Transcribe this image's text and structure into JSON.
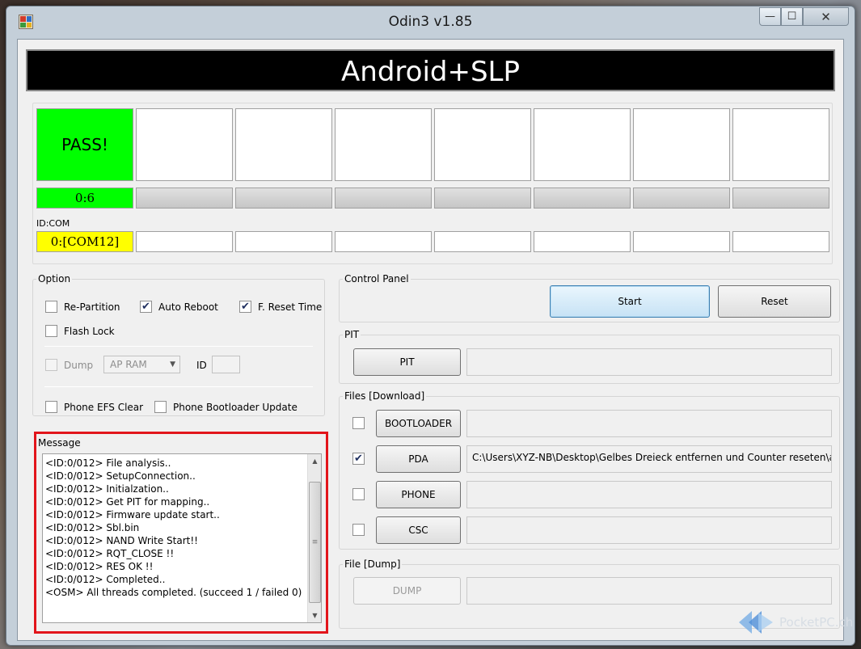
{
  "window": {
    "title": "Odin3 v1.85",
    "close_glyph": "✕",
    "minimize_glyph": "—",
    "maximize_glyph": "☐"
  },
  "banner": {
    "text": "Android+SLP"
  },
  "ports": {
    "status": [
      "PASS!",
      "",
      "",
      "",
      "",
      "",
      "",
      ""
    ],
    "progress": [
      "0:6",
      "",
      "",
      "",
      "",
      "",
      "",
      ""
    ],
    "idcom_label": "ID:COM",
    "com": [
      "0:[COM12]",
      "",
      "",
      "",
      "",
      "",
      "",
      ""
    ]
  },
  "option": {
    "title": "Option",
    "re_partition": {
      "label": "Re-Partition",
      "checked": false
    },
    "auto_reboot": {
      "label": "Auto Reboot",
      "checked": true
    },
    "f_reset_time": {
      "label": "F. Reset Time",
      "checked": true
    },
    "flash_lock": {
      "label": "Flash Lock",
      "checked": false
    },
    "dump": {
      "label": "Dump",
      "checked": false
    },
    "dump_select": "AP RAM",
    "id_label": "ID",
    "phone_efs_clear": {
      "label": "Phone EFS Clear",
      "checked": false
    },
    "phone_bootloader_update": {
      "label": "Phone Bootloader Update",
      "checked": false
    }
  },
  "message": {
    "title": "Message",
    "lines": [
      "<ID:0/012> File analysis..",
      "<ID:0/012> SetupConnection..",
      "<ID:0/012> Initialzation..",
      "<ID:0/012> Get PIT for mapping..",
      "<ID:0/012> Firmware update start..",
      "<ID:0/012> Sbl.bin",
      "<ID:0/012> NAND Write Start!!",
      "<ID:0/012> RQT_CLOSE !!",
      "<ID:0/012> RES OK !!",
      "<ID:0/012> Completed..",
      "<OSM> All threads completed. (succeed 1 / failed 0)"
    ]
  },
  "control_panel": {
    "title": "Control Panel",
    "start_label": "Start",
    "reset_label": "Reset"
  },
  "pit": {
    "title": "PIT",
    "button_label": "PIT",
    "path": ""
  },
  "files": {
    "title": "Files [Download]",
    "bootloader": {
      "label": "BOOTLOADER",
      "checked": false,
      "path": ""
    },
    "pda": {
      "label": "PDA",
      "checked": true,
      "path": "C:\\Users\\XYZ-NB\\Desktop\\Gelbes Dreieck entfernen und Counter reseten\\alte"
    },
    "phone": {
      "label": "PHONE",
      "checked": false,
      "path": ""
    },
    "csc": {
      "label": "CSC",
      "checked": false,
      "path": ""
    }
  },
  "file_dump": {
    "title": "File [Dump]",
    "button_label": "DUMP",
    "path": ""
  },
  "watermark": {
    "text": "PocketPC.ch"
  },
  "colors": {
    "pass": "#00ff00",
    "com_active": "#ffff00",
    "highlight": "#e2151b",
    "banner_bg": "#000000"
  }
}
